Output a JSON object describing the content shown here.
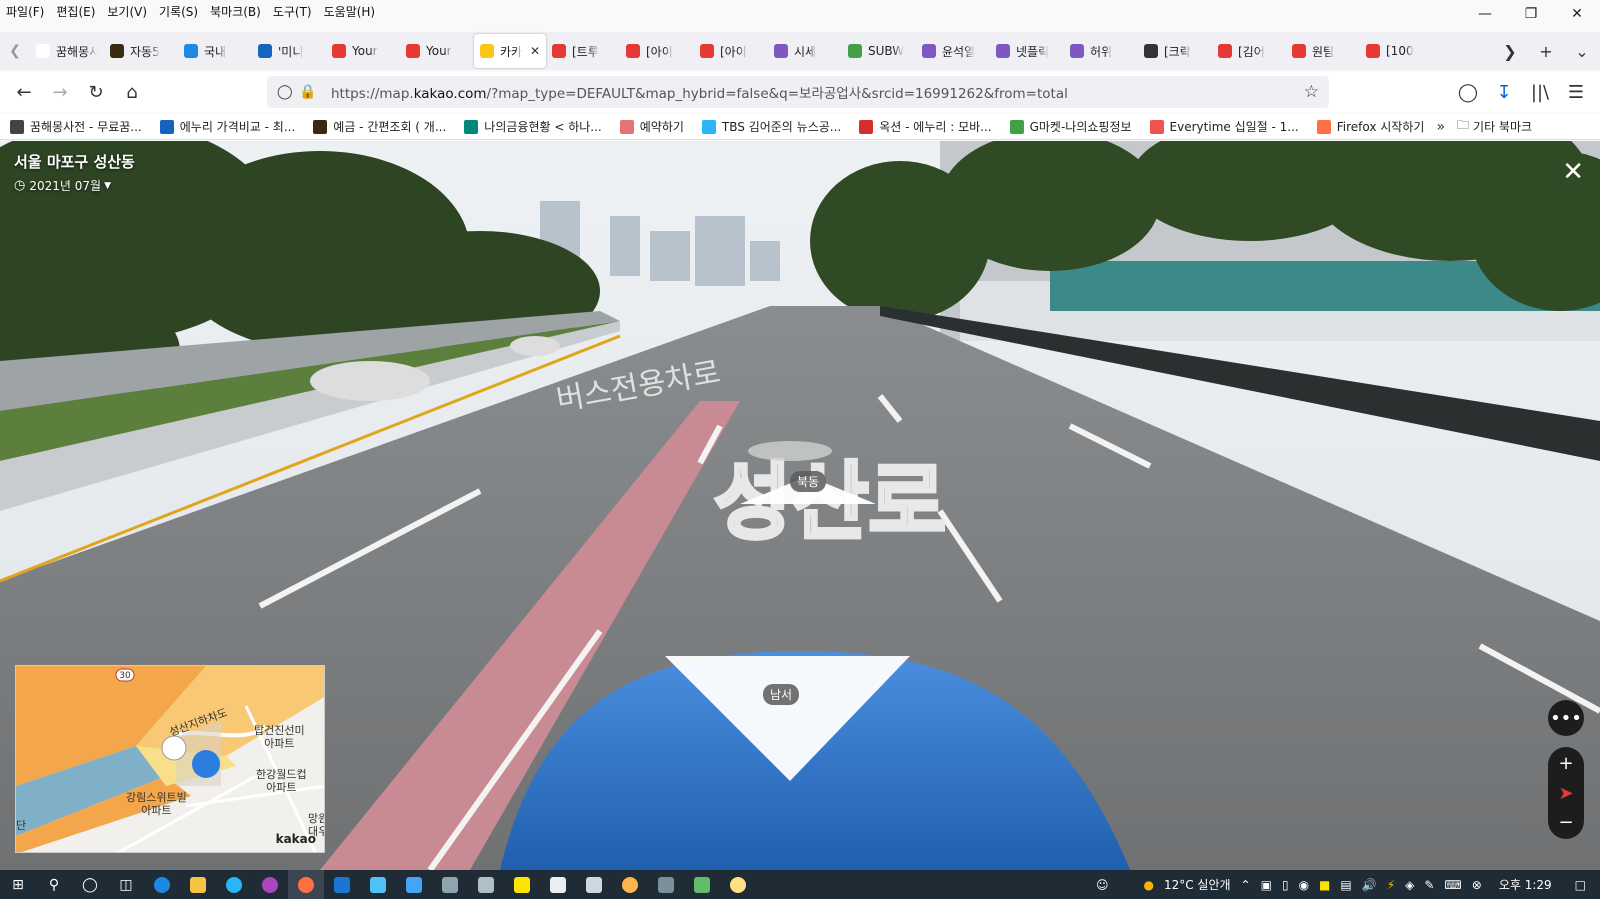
{
  "menubar": {
    "items": [
      "파일(F)",
      "편집(E)",
      "보기(V)",
      "기록(S)",
      "북마크(B)",
      "도구(T)",
      "도움말(H)"
    ]
  },
  "tabs": [
    {
      "title": "꿈해몽사전",
      "icon": "page-icon",
      "color": "#ffffff"
    },
    {
      "title": "자동5",
      "icon": "kakaobank-icon",
      "color": "#3a2a12"
    },
    {
      "title": "국내",
      "icon": "edge-icon",
      "color": "#1e88e5"
    },
    {
      "title": "'미니",
      "icon": "s-icon",
      "color": "#1565c0"
    },
    {
      "title": "Your",
      "icon": "youtube-red-icon",
      "color": "#e53935"
    },
    {
      "title": "Your",
      "icon": "youtube-red-icon",
      "color": "#e53935"
    },
    {
      "title": "카카",
      "icon": "kakaomap-pin-icon",
      "color": "#f9c516",
      "active": true
    },
    {
      "title": "[트루",
      "icon": "tmon-icon",
      "color": "#e53935"
    },
    {
      "title": "[아이",
      "icon": "tmon-icon",
      "color": "#e53935"
    },
    {
      "title": "[아이",
      "icon": "tmon-icon",
      "color": "#e53935"
    },
    {
      "title": "시세",
      "icon": "d-icon",
      "color": "#7e57c2"
    },
    {
      "title": "SUBW",
      "icon": "s-green-icon",
      "color": "#43a047"
    },
    {
      "title": "윤석열",
      "icon": "d-icon",
      "color": "#7e57c2"
    },
    {
      "title": "넷플릭",
      "icon": "d-icon",
      "color": "#7e57c2"
    },
    {
      "title": "허위",
      "icon": "d-icon",
      "color": "#7e57c2"
    },
    {
      "title": "[크락",
      "icon": "speaker-icon",
      "color": "#333333"
    },
    {
      "title": "[김어",
      "icon": "youtube-icon",
      "color": "#e53935"
    },
    {
      "title": "원팀",
      "icon": "youtube-icon",
      "color": "#e53935"
    },
    {
      "title": "[100",
      "icon": "youtube-icon",
      "color": "#e53935"
    }
  ],
  "navbar": {
    "url_prefix": "https://map.",
    "url_domain": "kakao.com",
    "url_rest": "/?map_type=DEFAULT&map_hybrid=false&q=보라공업사&srcid=16991262&from=total"
  },
  "bookmarks": [
    {
      "label": "꿈해몽사전 - 무료꿈...",
      "icon": "globe-icon",
      "color": "#444444"
    },
    {
      "label": "에누리 가격비교 - 최...",
      "icon": "enuri-icon",
      "color": "#1565c0"
    },
    {
      "label": "예금 - 간편조회 ( 개...",
      "icon": "kakaobank-icon",
      "color": "#3a2a12"
    },
    {
      "label": "나의금융현황 < 하나...",
      "icon": "hana-icon",
      "color": "#00897b"
    },
    {
      "label": "예약하기",
      "icon": "hand-icon",
      "color": "#e57373"
    },
    {
      "label": "TBS 김어준의 뉴스공...",
      "icon": "tbs-icon",
      "color": "#29b6f6"
    },
    {
      "label": "옥션 - 에누리 : 모바...",
      "icon": "auction-icon",
      "color": "#d32f2f"
    },
    {
      "label": "G마켓-나의쇼핑정보",
      "icon": "g-icon",
      "color": "#43a047"
    },
    {
      "label": "Everytime 십일절 - 1...",
      "icon": "11st-icon",
      "color": "#ef5350"
    },
    {
      "label": "Firefox 시작하기",
      "icon": "firefox-icon",
      "color": "#ff7043"
    }
  ],
  "bookmarks_other": "기타 북마크",
  "roadview": {
    "location": "서울 마포구 성산동",
    "date": "2021년 07월",
    "forward_direction": "북동",
    "back_direction": "남서",
    "road_text": "성산로",
    "lane_text": "버스전용차로"
  },
  "minimap": {
    "labels": [
      "성산지하차도",
      "탑건진선미\n아파트",
      "한강월드컵\n아파트",
      "강림스위트빌\n아파트",
      "망원\n대우",
      "단"
    ],
    "road_number": "30",
    "brand": "kakao"
  },
  "taskbar": {
    "weather": "12°C 실안개",
    "time": "오후 1:29"
  }
}
